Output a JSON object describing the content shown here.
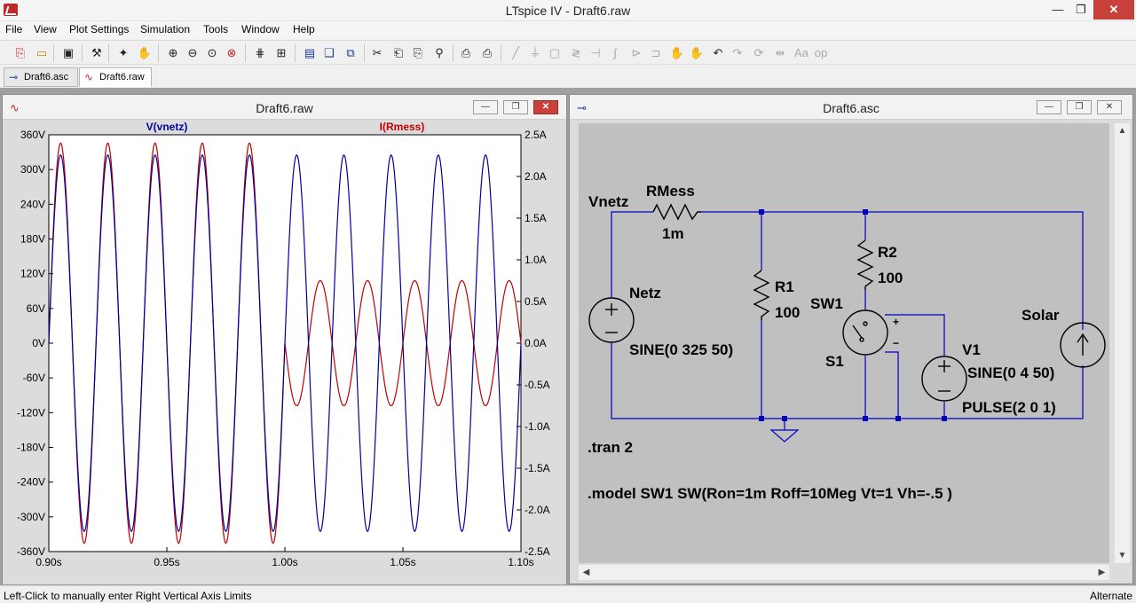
{
  "app": {
    "title": "LTspice IV - Draft6.raw",
    "minimize_icon": "minimize-icon",
    "maximize_icon": "restore-icon",
    "close_icon": "close-icon"
  },
  "menu": [
    "File",
    "View",
    "Plot Settings",
    "Simulation",
    "Tools",
    "Window",
    "Help"
  ],
  "toolbar_icons": [
    "new-schematic-icon",
    "open-icon",
    "save-icon",
    "control-panel-icon",
    "run-icon",
    "halt-icon",
    "zoom-in-icon",
    "zoom-out-icon",
    "zoom-fit-icon",
    "zoom-cancel-icon",
    "autorange-icon",
    "zoom-extents-icon",
    "tile-horizontal-icon",
    "cascade-icon",
    "close-all-icon",
    "cut-icon",
    "copy-icon",
    "paste-icon",
    "find-icon",
    "print-setup-icon",
    "print-icon",
    "wire-icon",
    "ground-icon",
    "label-icon",
    "resistor-icon",
    "capacitor-icon",
    "inductor-icon",
    "diode-icon",
    "component-icon",
    "move-icon",
    "drag-icon",
    "undo-icon",
    "redo-icon",
    "rotate-icon",
    "mirror-icon",
    "text-icon",
    "spice-directive-icon"
  ],
  "tabs": [
    {
      "label": "Draft6.asc",
      "icon": "schematic-icon"
    },
    {
      "label": "Draft6.raw",
      "icon": "waveform-icon"
    }
  ],
  "plot_window": {
    "title": "Draft6.raw",
    "min_label": "—",
    "restore_label": "❐",
    "close_label": "✕"
  },
  "schematic_window": {
    "title": "Draft6.asc",
    "min_label": "—",
    "restore_label": "❐",
    "close_label": "✕"
  },
  "chart_data": {
    "type": "line",
    "x": {
      "min": 0.9,
      "max": 1.1,
      "ticks": [
        "0.90s",
        "0.95s",
        "1.00s",
        "1.05s",
        "1.10s"
      ]
    },
    "y_left": {
      "min": -360,
      "max": 360,
      "ticks": [
        "360V",
        "300V",
        "240V",
        "180V",
        "120V",
        "60V",
        "0V",
        "-60V",
        "-120V",
        "-180V",
        "-240V",
        "-300V",
        "-360V"
      ]
    },
    "y_right": {
      "min": -2.5,
      "max": 2.5,
      "ticks": [
        "2.5A",
        "2.0A",
        "1.5A",
        "1.0A",
        "0.5A",
        "0.0A",
        "-0.5A",
        "-1.0A",
        "-1.5A",
        "-2.0A",
        "-2.5A"
      ]
    },
    "series": [
      {
        "name": "V(vnetz)",
        "color": "#00009e",
        "axis": "left",
        "amplitude": 325,
        "frequency_hz": 50,
        "phase_deg": 0
      },
      {
        "name": "I(Rmess)",
        "color": "#c00000",
        "axis": "right",
        "segments": [
          {
            "t_start": 0.9,
            "t_end": 1.0,
            "amplitude": 2.4,
            "frequency_hz": 50,
            "phase_deg": 0
          },
          {
            "t_start": 1.0,
            "t_end": 1.1,
            "amplitude": 0.75,
            "frequency_hz": 50,
            "phase_deg": 180
          }
        ]
      }
    ],
    "grid": false
  },
  "schematic": {
    "labels": {
      "vnetz": "Vnetz",
      "rmess": "RMess",
      "rmess_val": "1m",
      "netz": "Netz",
      "netz_val": "SINE(0 325 50)",
      "r1": "R1",
      "r1_val": "100",
      "r2": "R2",
      "r2_val": "100",
      "sw1": "SW1",
      "s1": "S1",
      "v1": "V1",
      "v1_sine": "SINE(0 4 50)",
      "v1_pulse": "PULSE(2 0 1)",
      "solar": "Solar",
      "plus": "+",
      "minus": "−",
      "tran": ".tran 2",
      "model": ".model SW1 SW(Ron=1m Roff=10Meg Vt=1 Vh=-.5 )"
    },
    "wire_color": "#0000c0",
    "component_color": "#000000"
  },
  "status": {
    "left": "Left-Click to manually enter Right Vertical Axis Limits",
    "right": "Alternate"
  }
}
